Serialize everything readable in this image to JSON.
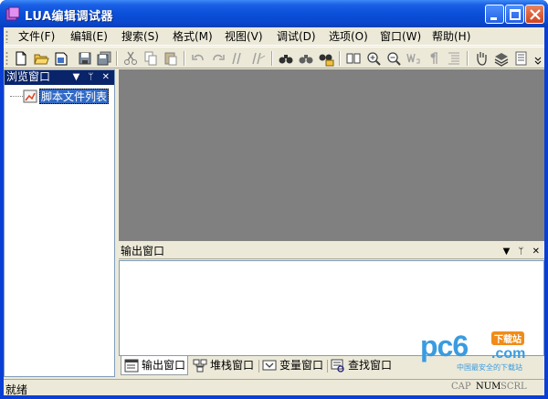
{
  "window": {
    "title": "LUA编辑调试器",
    "accent": "#0a48cf",
    "close_color": "#d1431f"
  },
  "menu": [
    {
      "label": "文件(F)"
    },
    {
      "label": "编辑(E)"
    },
    {
      "label": "搜索(S)"
    },
    {
      "label": "格式(M)"
    },
    {
      "label": "视图(V)"
    },
    {
      "label": "调试(D)"
    },
    {
      "label": "选项(O)"
    },
    {
      "label": "窗口(W)"
    },
    {
      "label": "帮助(H)"
    }
  ],
  "toolbar_icons": [
    "new-file-icon",
    "open-folder-icon",
    "open-project-icon",
    "save-icon",
    "save-all-icon",
    "cut-icon",
    "copy-icon",
    "paste-icon",
    "undo-icon",
    "redo-icon",
    "comment-icon",
    "uncomment-icon",
    "find-icon",
    "find-next-icon",
    "find-in-files-icon",
    "bookmark-icon",
    "zoom-in-icon",
    "zoom-out-icon",
    "word-wrap-icon",
    "show-whitespace-icon",
    "indent-icon",
    "hand-icon",
    "layers-icon",
    "list-icon"
  ],
  "browser_pane": {
    "title": "浏览窗口",
    "header_icons": "▼ ᛘ ✕",
    "tree": [
      {
        "label": "脚本文件列表"
      }
    ]
  },
  "output_pane": {
    "title": "输出窗口",
    "header_icons": "▼ ᛘ ✕",
    "tabs": [
      {
        "label": "输出窗口",
        "active": true
      },
      {
        "label": "堆栈窗口",
        "active": false
      },
      {
        "label": "变量窗口",
        "active": false
      },
      {
        "label": "查找窗口",
        "active": false
      }
    ]
  },
  "status": {
    "text": "就绪",
    "indicators": [
      {
        "label": "CAP",
        "on": false
      },
      {
        "label": "NUM",
        "on": true
      },
      {
        "label": "SCRL",
        "on": false
      }
    ]
  },
  "watermark": {
    "main": "pc6",
    "badge": "下载站",
    "domain": ".com",
    "tagline": "中国最安全的下载站"
  }
}
